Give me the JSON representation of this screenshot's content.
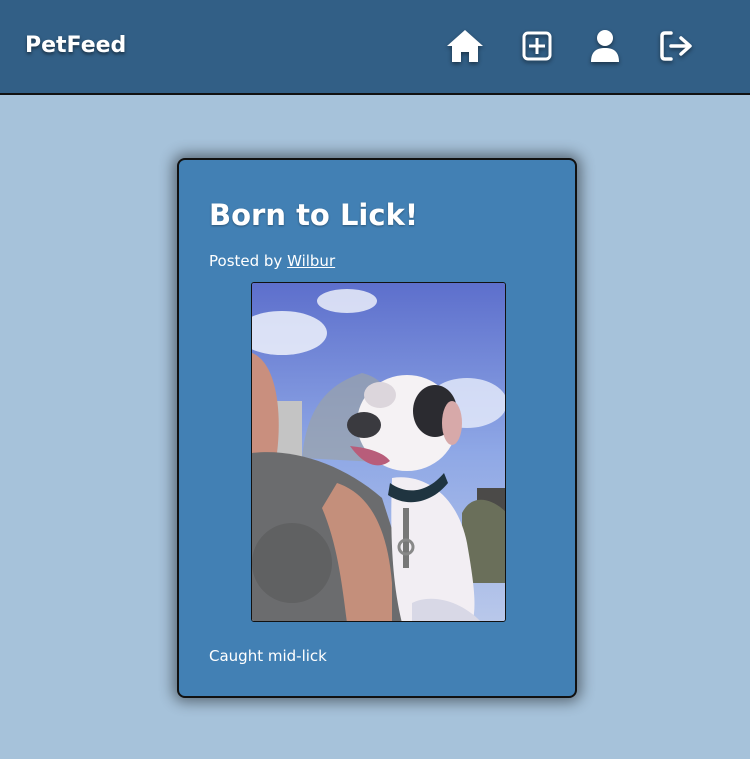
{
  "navbar": {
    "brand": "PetFeed",
    "icons": [
      "home-icon",
      "add-post-icon",
      "profile-icon",
      "logout-icon"
    ]
  },
  "post": {
    "title": "Born to Lick!",
    "posted_by_prefix": "Posted by ",
    "author": "Wilbur",
    "caption": "Caught mid-lick"
  },
  "colors": {
    "page_bg": "#a6c2da",
    "navbar_bg": "#325f86",
    "card_bg": "#4280b4"
  }
}
